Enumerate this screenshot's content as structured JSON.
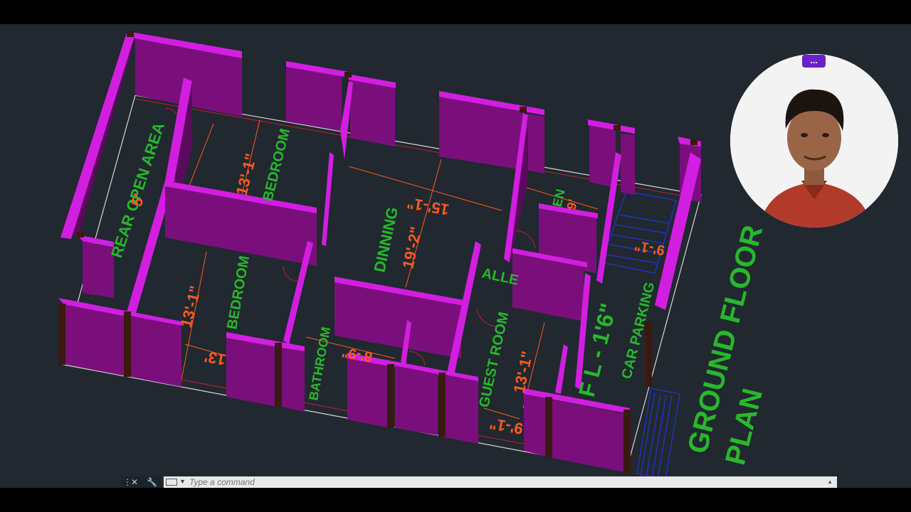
{
  "drawing": {
    "title_line1": "GROUND FLOOR",
    "title_line2": "PLAN",
    "rooms": {
      "rear_open_area": "REAR OPEN AREA",
      "rear_dim": "5'",
      "bedroom_top": "BEDROOM",
      "bedroom_top_dim": "13'-1\"",
      "dinning": "DINNING",
      "dinning_w": "15'-1\"",
      "dinning_h": "19'-2\"",
      "kitchen_partial": "EN",
      "kitchen_dim": "9'",
      "stair_dim": "9'-1\"",
      "alley_partial": "ALLE",
      "bedroom_bottom": "BEDROOM",
      "bedroom_bottom_dim1": "13'-1\"",
      "bedroom_bottom_dim2": "13'",
      "bathroom": "BATHROOM",
      "bathroom_dim": "8'-9\"",
      "guest_room": "GUEST ROOM",
      "guest_dim1": "13'-1\"",
      "guest_dim2": "9'-1\"",
      "car_parking": "CAR PARKING",
      "floor_level": "F L - 1'6\""
    }
  },
  "webcam": {
    "menu_label": "..."
  },
  "command_line": {
    "close_symbol": "✕",
    "wrench_symbol": "🔧",
    "grip_symbol": "⋮",
    "placeholder": "Type a command",
    "caret": "▼",
    "up_arrow": "▲"
  }
}
